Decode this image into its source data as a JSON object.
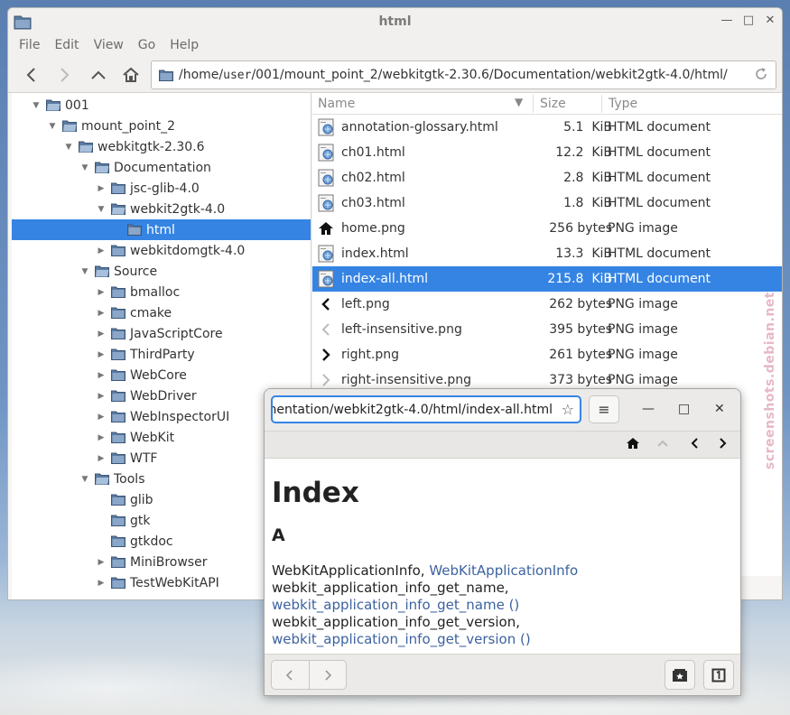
{
  "file_manager": {
    "title": "html",
    "menu": [
      "File",
      "Edit",
      "View",
      "Go",
      "Help"
    ],
    "location": {
      "prefix": "/home/",
      "user": "user",
      "suffix": " /001/mount_point_2/webkitgtk-2.30.6/Documentation/webkit2gtk-4.0/html/"
    },
    "tree": [
      {
        "label": "001",
        "depth": 1,
        "expanded": true
      },
      {
        "label": "mount_point_2",
        "depth": 2,
        "expanded": true
      },
      {
        "label": "webkitgtk-2.30.6",
        "depth": 3,
        "expanded": true
      },
      {
        "label": "Documentation",
        "depth": 4,
        "expanded": true
      },
      {
        "label": "jsc-glib-4.0",
        "depth": 5,
        "expanded": false
      },
      {
        "label": "webkit2gtk-4.0",
        "depth": 5,
        "expanded": true
      },
      {
        "label": "html",
        "depth": 6,
        "leaf": true,
        "selected": true
      },
      {
        "label": "webkitdomgtk-4.0",
        "depth": 5,
        "expanded": false
      },
      {
        "label": "Source",
        "depth": 4,
        "expanded": true
      },
      {
        "label": "bmalloc",
        "depth": 5,
        "expanded": false
      },
      {
        "label": "cmake",
        "depth": 5,
        "expanded": false
      },
      {
        "label": "JavaScriptCore",
        "depth": 5,
        "expanded": false
      },
      {
        "label": "ThirdParty",
        "depth": 5,
        "expanded": false
      },
      {
        "label": "WebCore",
        "depth": 5,
        "expanded": false
      },
      {
        "label": "WebDriver",
        "depth": 5,
        "expanded": false
      },
      {
        "label": "WebInspectorUI",
        "depth": 5,
        "expanded": false
      },
      {
        "label": "WebKit",
        "depth": 5,
        "expanded": false
      },
      {
        "label": "WTF",
        "depth": 5,
        "expanded": false
      },
      {
        "label": "Tools",
        "depth": 4,
        "expanded": true
      },
      {
        "label": "glib",
        "depth": 5,
        "leaf": true
      },
      {
        "label": "gtk",
        "depth": 5,
        "leaf": true
      },
      {
        "label": "gtkdoc",
        "depth": 5,
        "leaf": true
      },
      {
        "label": "MiniBrowser",
        "depth": 5,
        "expanded": false
      },
      {
        "label": "TestWebKitAPI",
        "depth": 5,
        "expanded": false
      }
    ],
    "columns": {
      "name": "Name",
      "size": "Size",
      "type": "Type"
    },
    "files": [
      {
        "name": "annotation-glossary.html",
        "size": "5.1  KiB",
        "type": "HTML document",
        "icon": "html-file-icon"
      },
      {
        "name": "ch01.html",
        "size": "12.2  KiB",
        "type": "HTML document",
        "icon": "html-file-icon"
      },
      {
        "name": "ch02.html",
        "size": "2.8  KiB",
        "type": "HTML document",
        "icon": "html-file-icon"
      },
      {
        "name": "ch03.html",
        "size": "1.8  KiB",
        "type": "HTML document",
        "icon": "html-file-icon"
      },
      {
        "name": "home.png",
        "size": "256 bytes",
        "type": "PNG image",
        "icon": "home-icon"
      },
      {
        "name": "index.html",
        "size": "13.3  KiB",
        "type": "HTML document",
        "icon": "html-file-icon"
      },
      {
        "name": "index-all.html",
        "size": "215.8  KiB",
        "type": "HTML document",
        "icon": "html-file-icon",
        "selected": true
      },
      {
        "name": "left.png",
        "size": "262 bytes",
        "type": "PNG image",
        "icon": "left-arrow-icon"
      },
      {
        "name": "left-insensitive.png",
        "size": "395 bytes",
        "type": "PNG image",
        "icon": "left-arrow-light-icon"
      },
      {
        "name": "right.png",
        "size": "261 bytes",
        "type": "PNG image",
        "icon": "right-arrow-icon"
      },
      {
        "name": "right-insensitive.png",
        "size": "373 bytes",
        "type": "PNG image",
        "icon": "right-arrow-light-icon"
      }
    ]
  },
  "watermark": "screenshots.debian.net",
  "browser": {
    "url": "mentation/webkit2gtk-4.0/html/index-all.html",
    "heading": "Index",
    "section": "A",
    "entries": [
      {
        "text": "WebKitApplicationInfo, ",
        "link": "WebKitApplicationInfo"
      },
      {
        "text": "webkit_application_info_get_name,",
        "link": ""
      },
      {
        "text": "",
        "link": "webkit_application_info_get_name ()"
      },
      {
        "text": "webkit_application_info_get_version,",
        "link": ""
      },
      {
        "text": "",
        "link": "webkit_application_info_get_version ()"
      }
    ]
  },
  "colors": {
    "accent": "#3584e4",
    "link": "#3c62a0"
  }
}
